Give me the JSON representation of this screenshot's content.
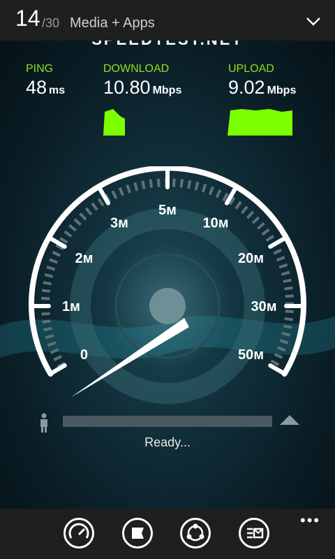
{
  "header": {
    "index": "14",
    "total": "/30",
    "title": "Media + Apps",
    "chevron_icon": "chevron-down-icon"
  },
  "app": {
    "logo_text": "SPEEDTEST.NET",
    "ping": {
      "label": "PING",
      "value": "48",
      "unit": "ms"
    },
    "download": {
      "label": "DOWNLOAD",
      "value": "10.80",
      "unit": "Mbps"
    },
    "upload": {
      "label": "UPLOAD",
      "value": "9.02",
      "unit": "Mbps"
    },
    "graph_color": "#7dff00",
    "gauge": {
      "ticks": [
        "0",
        "1м",
        "2м",
        "3м",
        "5м",
        "10м",
        "20м",
        "30м",
        "50м"
      ],
      "needle_value": "0"
    },
    "progress": 0,
    "status": "Ready..."
  },
  "appbar": {
    "buttons": [
      "speedometer-icon",
      "flag-icon",
      "share-icon",
      "results-icon"
    ],
    "more": "•••"
  }
}
